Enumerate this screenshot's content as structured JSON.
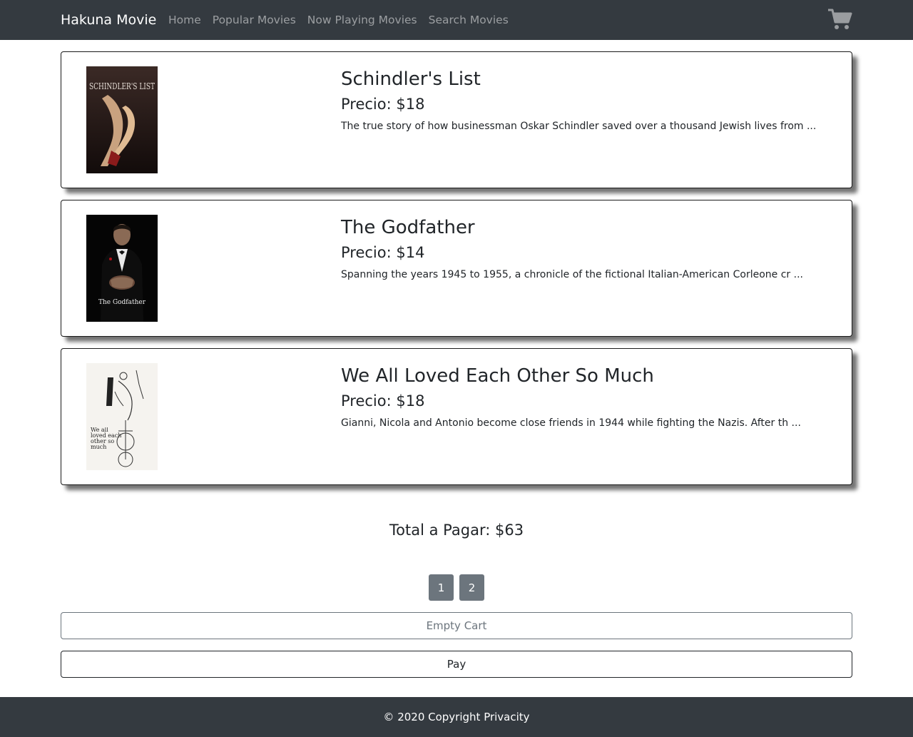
{
  "navbar": {
    "brand": "Hakuna Movie",
    "links": [
      "Home",
      "Popular Movies",
      "Now Playing Movies",
      "Search Movies"
    ],
    "cart_icon": "shopping-cart-icon"
  },
  "cart": {
    "items": [
      {
        "title": "Schindler's List",
        "price": "Precio: $18",
        "description": "The true story of how businessman Oskar Schindler saved over a thousand Jewish lives from ...",
        "poster_text": "SCHINDLER'S LIST"
      },
      {
        "title": "The Godfather",
        "price": "Precio: $14",
        "description": "Spanning the years 1945 to 1955, a chronicle of the fictional Italian-American Corleone cr ...",
        "poster_text": "The Godfather"
      },
      {
        "title": "We All Loved Each Other So Much",
        "price": "Precio: $18",
        "description": "Gianni, Nicola and Antonio become close friends in 1944 while fighting the Nazis. After th ...",
        "poster_text": "We all loved each other so much"
      }
    ],
    "total": "Total a Pagar: $63"
  },
  "pagination": {
    "pages": [
      "1",
      "2"
    ]
  },
  "buttons": {
    "empty_cart": "Empty Cart",
    "pay": "Pay"
  },
  "footer": {
    "text": "© 2020 Copyright Privacity"
  }
}
